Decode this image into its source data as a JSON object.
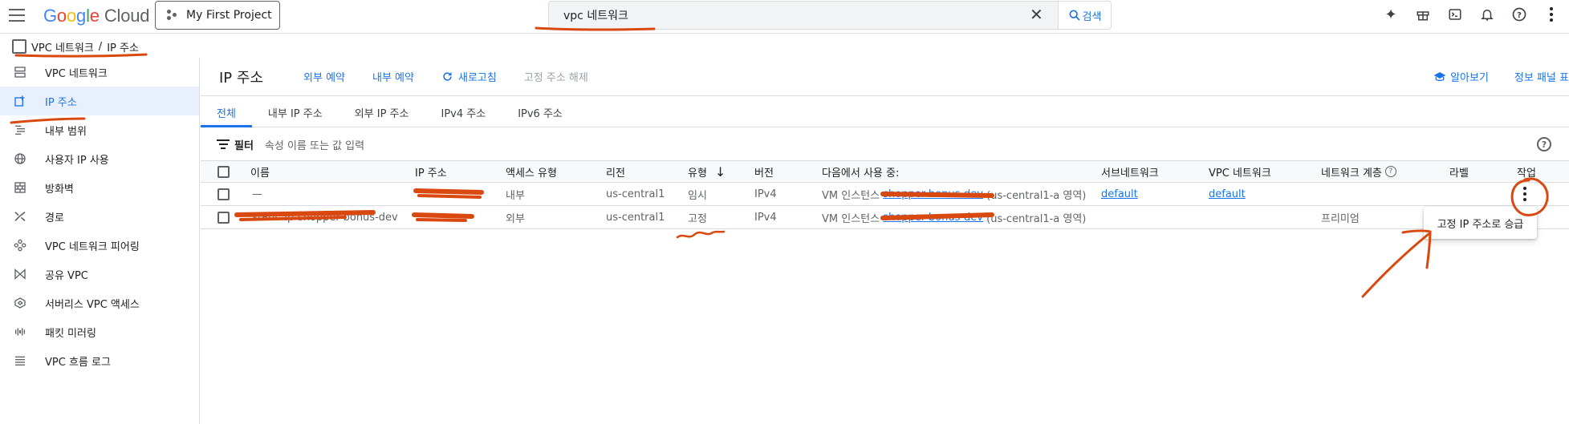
{
  "topbar": {
    "logo_google": [
      "G",
      "o",
      "o",
      "g",
      "l",
      "e"
    ],
    "logo_cloud": "Cloud",
    "project_label": "My First Project",
    "search_value": "vpc 네트워크",
    "search_button_label": "검색",
    "icons": [
      "sparkle-icon",
      "gift-icon",
      "terminal-icon",
      "bell-icon",
      "help-icon",
      "more-vert-icon"
    ]
  },
  "breadcrumb": {
    "items": [
      "VPC 네트워크",
      "IP 주소"
    ],
    "separator": "/"
  },
  "sidebar": {
    "items": [
      {
        "label": "VPC 네트워크",
        "icon": "vpc-network-icon"
      },
      {
        "label": "IP 주소",
        "icon": "ip-address-icon",
        "active": true
      },
      {
        "label": "내부 범위",
        "icon": "internal-range-icon"
      },
      {
        "label": "사용자 IP 사용",
        "icon": "globe-icon"
      },
      {
        "label": "방화벽",
        "icon": "firewall-icon"
      },
      {
        "label": "경로",
        "icon": "route-icon"
      },
      {
        "label": "VPC 네트워크 피어링",
        "icon": "peering-icon"
      },
      {
        "label": "공유 VPC",
        "icon": "shared-vpc-icon"
      },
      {
        "label": "서버리스 VPC 액세스",
        "icon": "serverless-icon"
      },
      {
        "label": "패킷 미러링",
        "icon": "packet-mirroring-icon"
      },
      {
        "label": "VPC 흐름 로그",
        "icon": "flow-logs-icon"
      }
    ]
  },
  "header": {
    "title": "IP 주소",
    "actions": [
      "외부 예약",
      "내부 예약",
      "새로고침",
      "고정 주소 해제"
    ],
    "learn_label": "알아보기",
    "info_panel_label": "정보 패널 표"
  },
  "tabs": [
    "전체",
    "내부 IP 주소",
    "외부 IP 주소",
    "IPv4 주소",
    "IPv6 주소"
  ],
  "filter": {
    "label": "필터",
    "placeholder": "속성 이름 또는 값 입력"
  },
  "table": {
    "columns": [
      "이름",
      "IP 주소",
      "액세스 유형",
      "리전",
      "유형",
      "버전",
      "다음에서 사용 중:",
      "서브네트워크",
      "VPC 네트워크",
      "네트워크 계층",
      "라벨",
      "작업"
    ],
    "rows": [
      {
        "name": "—",
        "ip": "",
        "access": "내부",
        "region": "us-central1",
        "type": "임시",
        "version": "IPv4",
        "used_by_prefix": "VM 인스턴스",
        "used_by_link": "shopper-bonus-dev",
        "used_by_suffix": "(us-central1-a 영역)",
        "subnetwork": "default",
        "vpc_network": "default",
        "tier": "",
        "label": ""
      },
      {
        "name": "static-ip-shopper-bonus-dev",
        "ip": "",
        "access": "외부",
        "region": "us-central1",
        "type": "고정",
        "version": "IPv4",
        "used_by_prefix": "VM 인스턴스",
        "used_by_link": "shopper-bonus-dev",
        "used_by_suffix": "(us-central1-a 영역)",
        "subnetwork": "",
        "vpc_network": "",
        "tier": "프리미엄",
        "label": ""
      }
    ]
  },
  "popup_menu": {
    "items": [
      "고정 IP 주소로 승급"
    ]
  },
  "colors": {
    "accent": "#1a73e8",
    "annotation": "#d9480f",
    "active_bg": "#e8f0fe"
  }
}
